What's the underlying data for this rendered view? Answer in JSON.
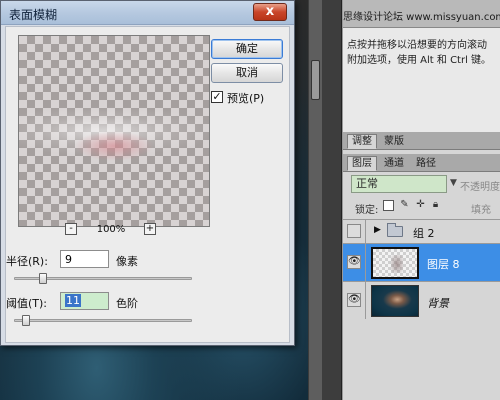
{
  "dialog": {
    "title": "表面模糊",
    "close_label": "x",
    "ok_label": "确定",
    "cancel_label": "取消",
    "preview_label": "预览(P)",
    "preview_checked": true,
    "zoom": {
      "minus_label": "-",
      "plus_label": "+",
      "value": "100%"
    },
    "radius": {
      "label": "半径(R):",
      "value": "9",
      "unit": "像素",
      "slider_fraction": 0.14
    },
    "threshold": {
      "label": "阈值(T):",
      "value": "11",
      "unit": "色阶",
      "slider_fraction": 0.04
    }
  },
  "info_panel": {
    "watermark": "思缘设计论坛 www.missyuan.com",
    "hint_line1": "点按并拖移以沿想要的方向滚动",
    "hint_line2": "附加选项，使用 Alt 和 Ctrl 键。"
  },
  "layers_panel": {
    "top_tabs": [
      "调整",
      "蒙版"
    ],
    "tabs": [
      "图层",
      "通道",
      "路径"
    ],
    "blend_mode": "正常",
    "opacity_label": "不透明度",
    "lock_label": "锁定:",
    "fill_label": "填充",
    "layers": [
      {
        "name": "组 2",
        "type": "group",
        "visible": false
      },
      {
        "name": "图层 8",
        "type": "layer",
        "visible": true,
        "selected": true
      },
      {
        "name": "背景",
        "type": "background",
        "visible": true
      }
    ]
  },
  "icons": {
    "eye": "eye-icon",
    "folder": "folder-icon",
    "expand": "triangle-right-icon",
    "check": "checkmark-icon"
  },
  "colors": {
    "selected_layer": "#3d8ee6",
    "blend_bg": "#cfe6c9",
    "close_button": "#c9452a"
  }
}
